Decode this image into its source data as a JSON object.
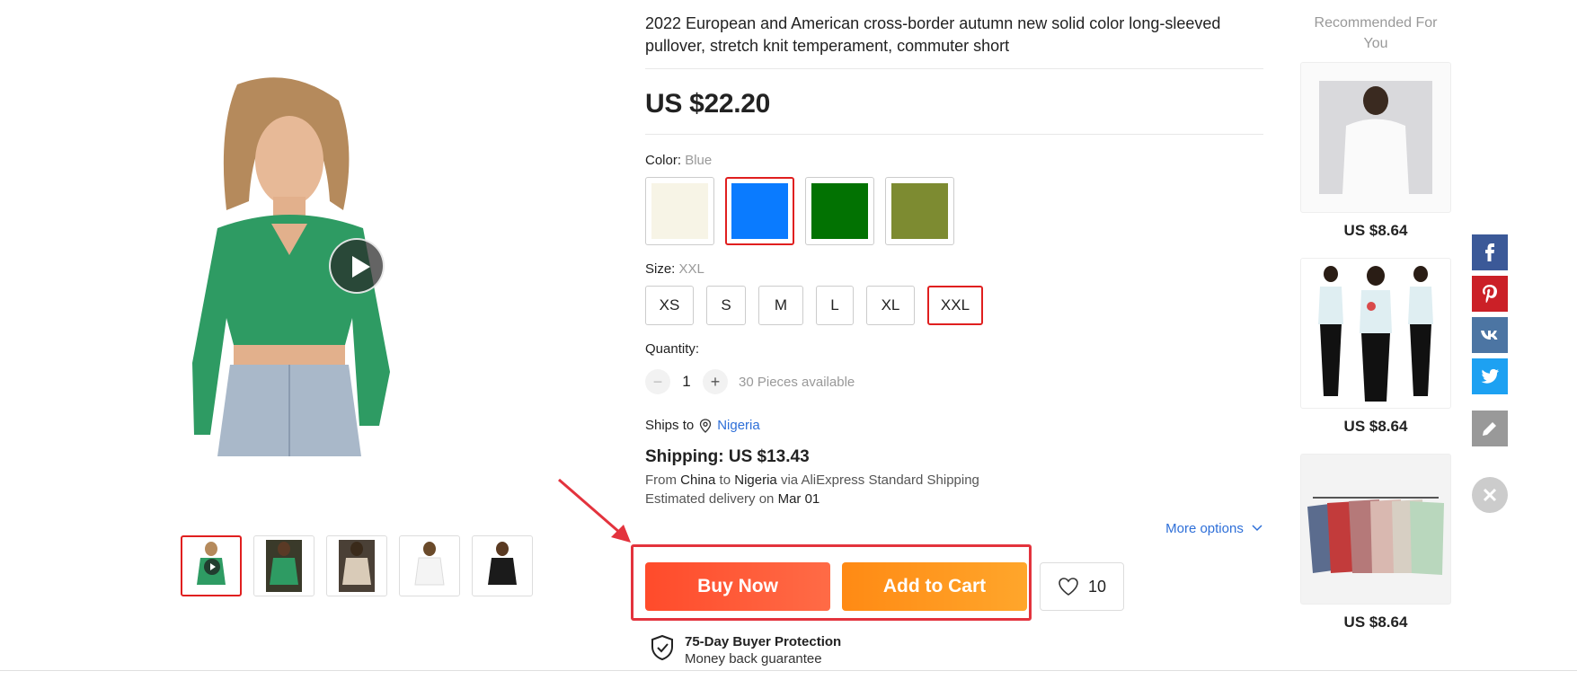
{
  "product": {
    "title": "2022 European and American cross-border autumn new solid color long-sleeved pullover, stretch knit temperament, commuter short",
    "price": "US $22.20",
    "color_label": "Color:",
    "color_selected": "Blue",
    "colors": [
      {
        "name": "Beige",
        "hex": "#f7f4e6",
        "selected": false
      },
      {
        "name": "Blue",
        "hex": "#0a7bff",
        "selected": true
      },
      {
        "name": "Green",
        "hex": "#027202",
        "selected": false
      },
      {
        "name": "Olive",
        "hex": "#7d8b31",
        "selected": false
      }
    ],
    "size_label": "Size:",
    "size_selected": "XXL",
    "sizes": [
      "XS",
      "S",
      "M",
      "L",
      "XL",
      "XXL"
    ],
    "quantity_label": "Quantity:",
    "quantity_minus": "−",
    "quantity_value": "1",
    "quantity_plus": "+",
    "quantity_available": "30 Pieces available",
    "ships_to_label": "Ships to",
    "ships_to_country": "Nigeria",
    "shipping_cost": "Shipping: US $13.43",
    "shipping_route": {
      "from_word": "From",
      "from": "China",
      "to_word": "to",
      "to": "Nigeria",
      "via": "via AliExpress Standard Shipping"
    },
    "delivery_prefix": "Estimated delivery on",
    "delivery_date": "Mar 01",
    "more_options": "More options",
    "buy_now": "Buy Now",
    "add_to_cart": "Add to Cart",
    "wishlist_count": "10",
    "protection_title": "75-Day Buyer Protection",
    "protection_sub": "Money back guarantee"
  },
  "recommended": {
    "title": "Recommended For You",
    "items": [
      {
        "price": "US $8.64"
      },
      {
        "price": "US $8.64"
      },
      {
        "price": "US $8.64"
      }
    ]
  },
  "share": {
    "facebook_color": "#3b5998",
    "pinterest_color": "#cb2027",
    "vk_color": "#4c75a3",
    "twitter_color": "#1da1f2",
    "edit_color": "#999999",
    "close_color": "#cccccc"
  },
  "annotation": {
    "highlight_color": "#e3333d"
  }
}
